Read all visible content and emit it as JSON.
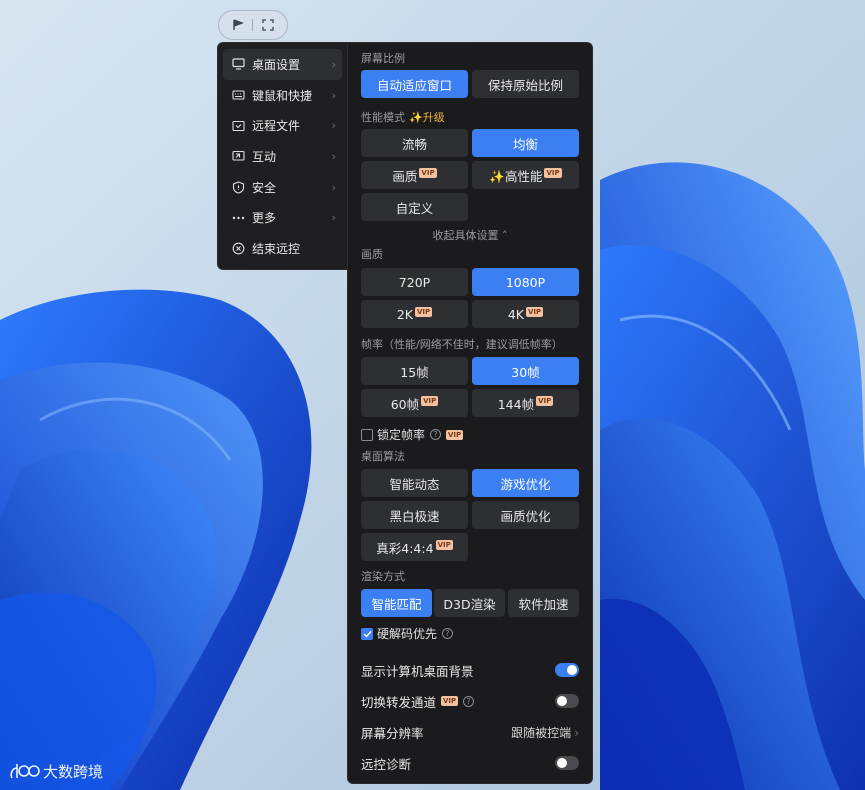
{
  "toolbar": {
    "icons": [
      "flag-icon",
      "fullscreen-icon"
    ]
  },
  "menu": {
    "items": [
      {
        "label": "桌面设置",
        "icon": "monitor-icon",
        "arrow": "›"
      },
      {
        "label": "键鼠和快捷",
        "icon": "keyboard-icon",
        "arrow": "›"
      },
      {
        "label": "远程文件",
        "icon": "file-icon",
        "arrow": "›"
      },
      {
        "label": "互动",
        "icon": "interact-icon",
        "arrow": "›"
      },
      {
        "label": "安全",
        "icon": "shield-icon",
        "arrow": "›"
      },
      {
        "label": "更多",
        "icon": "more-icon",
        "arrow": "›"
      },
      {
        "label": "结束远控",
        "icon": "close-circle-icon",
        "arrow": ""
      }
    ]
  },
  "panel": {
    "aspect": {
      "title": "屏幕比例",
      "options": [
        "自动适应窗口",
        "保持原始比例"
      ],
      "selected": "自动适应窗口"
    },
    "performance": {
      "title": "性能模式",
      "upgrade": "✨升级",
      "options": [
        "流畅",
        "均衡",
        "画质",
        "✨高性能",
        "自定义"
      ],
      "selected": "均衡",
      "collapse": "收起具体设置 ˄"
    },
    "quality": {
      "title": "画质",
      "options": [
        "720P",
        "1080P",
        "2K",
        "4K"
      ],
      "selected": "1080P"
    },
    "framerate": {
      "title": "帧率（性能/网络不佳时，建议调低帧率）",
      "options": [
        "15帧",
        "30帧",
        "60帧",
        "144帧"
      ],
      "selected": "30帧",
      "lock_label": "锁定帧率",
      "lock_checked": false
    },
    "algorithm": {
      "title": "桌面算法",
      "options": [
        "智能动态",
        "游戏优化",
        "黑白极速",
        "画质优化",
        "真彩4:4:4"
      ],
      "selected": "游戏优化"
    },
    "render": {
      "title": "渲染方式",
      "options": [
        "智能匹配",
        "D3D渲染",
        "软件加速"
      ],
      "selected": "智能匹配",
      "hw_decode_label": "硬解码优先",
      "hw_decode_checked": true
    },
    "settings": {
      "show_bg_label": "显示计算机桌面背景",
      "show_bg_on": true,
      "relay_label": "切换转发通道",
      "relay_on": false,
      "resolution_label": "屏幕分辨率",
      "resolution_value": "跟随被控端",
      "diagnose_label": "远控诊断",
      "diagnose_on": false
    },
    "vip_badge": "VIP"
  },
  "watermark": {
    "text": "大数跨境"
  },
  "colors": {
    "accent": "#3c7ff3",
    "panel_bg": "#1b1b1d",
    "button_bg": "#2e2f33",
    "upgrade": "#f0b43c"
  }
}
